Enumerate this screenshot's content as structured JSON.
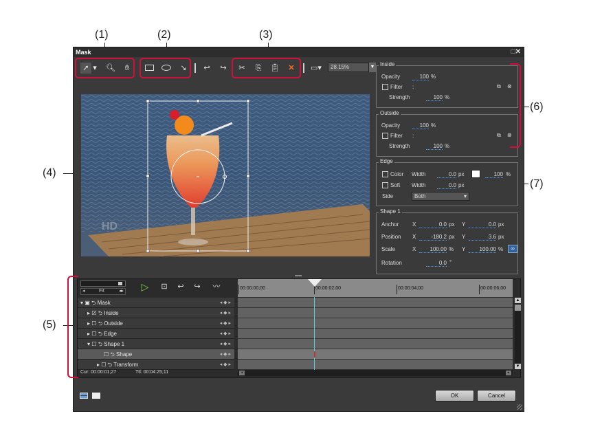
{
  "callouts": {
    "c1": "(1)",
    "c2": "(2)",
    "c3": "(3)",
    "c4": "(4)",
    "c5": "(5)",
    "c6": "(6)",
    "c7": "(7)"
  },
  "window": {
    "title": "Mask",
    "controls": "□✕"
  },
  "toolbar": {
    "icons": [
      "select-arrow-icon",
      "dropdown-icon",
      "zoom-icon",
      "hand-icon",
      "rectangle-icon",
      "ellipse-icon",
      "pen-icon",
      "undo-icon",
      "redo-icon",
      "cut-icon",
      "copy-icon",
      "paste-icon",
      "delete-icon",
      "view-icon"
    ],
    "zoom": "28.15%"
  },
  "preview": {
    "watermark": "HD"
  },
  "inside": {
    "label": "Inside",
    "opacity_label": "Opacity",
    "opacity": "100",
    "pct": "%",
    "filter_label": "Filter",
    "filter_colon": ":",
    "strength_label": "Strength",
    "strength": "100"
  },
  "outside": {
    "label": "Outside",
    "opacity_label": "Opacity",
    "opacity": "100",
    "pct": "%",
    "filter_label": "Filter",
    "filter_colon": ":",
    "strength_label": "Strength",
    "strength": "100"
  },
  "edge": {
    "label": "Edge",
    "color_label": "Color",
    "width_label": "Width",
    "color_width": "0.0",
    "px": "px",
    "color_pct": "100",
    "soft_label": "Soft",
    "soft_width": "0.0",
    "side_label": "Side",
    "side_value": "Both"
  },
  "shape1": {
    "label": "Shape 1",
    "anchor": "Anchor",
    "position": "Position",
    "scale": "Scale",
    "rotation": "Rotation",
    "x": "X",
    "y": "Y",
    "anchor_x": "0.0",
    "anchor_y": "0.0",
    "pos_x": "-180.2",
    "pos_y": "3.6",
    "scale_x": "100.00",
    "scale_y": "100.00",
    "rot": "0.0",
    "deg": "°",
    "px": "px",
    "pct": "%"
  },
  "timeline": {
    "fit": "Fit",
    "ruler": [
      "00:00:00;00",
      "00:00:02;00",
      "00:00:04;00",
      "00:00:06;00"
    ],
    "tracks": [
      {
        "name": "Mask"
      },
      {
        "name": "Inside"
      },
      {
        "name": "Outside"
      },
      {
        "name": "Edge"
      },
      {
        "name": "Shape 1"
      },
      {
        "name": "Shape"
      },
      {
        "name": "Transform"
      }
    ],
    "cur": "Cur: 00:00:01;27",
    "ttl": "Ttl: 00:04:25;11"
  },
  "footer": {
    "ok": "OK",
    "cancel": "Cancel"
  }
}
